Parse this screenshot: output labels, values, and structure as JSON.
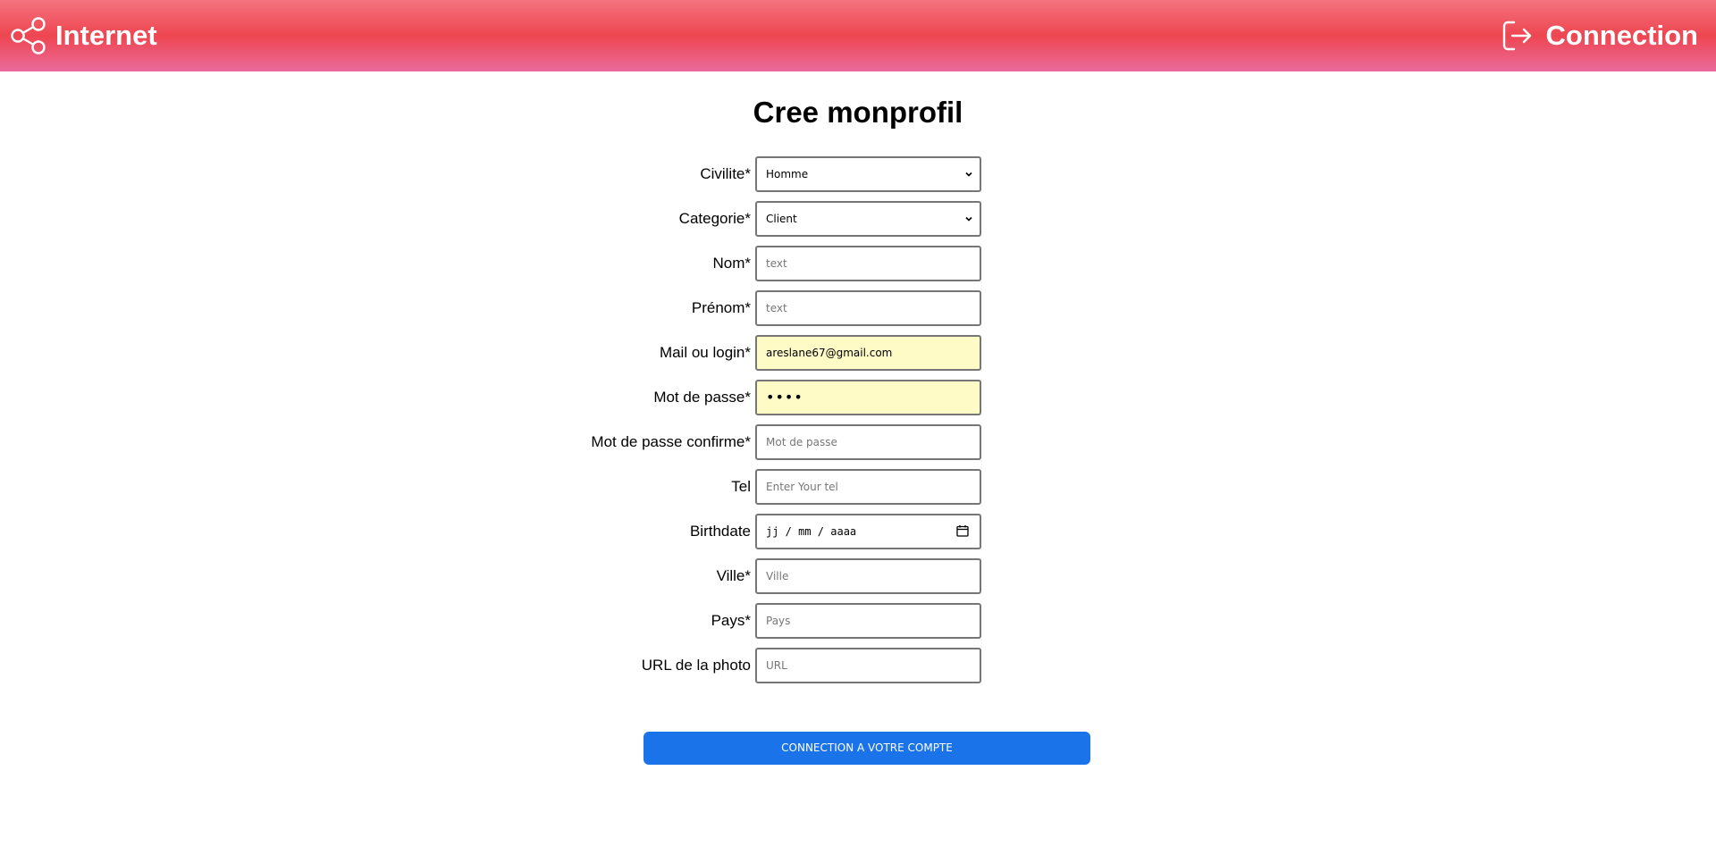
{
  "header": {
    "brand_label": "Internet",
    "connection_label": "Connection",
    "brand_icon": "share-icon",
    "connection_icon": "logout-icon"
  },
  "page": {
    "title": "Cree monprofil"
  },
  "form": {
    "civilite": {
      "label": "Civilite*",
      "value": "Homme"
    },
    "categorie": {
      "label": "Categorie*",
      "value": "Client"
    },
    "nom": {
      "label": "Nom*",
      "placeholder": "text"
    },
    "prenom": {
      "label": "Prénom*",
      "placeholder": "text"
    },
    "mail": {
      "label": "Mail ou login*",
      "value": "areslane67@gmail.com"
    },
    "password": {
      "label": "Mot de passe*",
      "value": "••••"
    },
    "password_confirm": {
      "label": "Mot de passe confirme*",
      "placeholder": "Mot de passe"
    },
    "tel": {
      "label": "Tel",
      "placeholder": "Enter Your tel"
    },
    "birthdate": {
      "label": "Birthdate",
      "value": "jj / mm / aaaa"
    },
    "ville": {
      "label": "Ville*",
      "placeholder": "Ville"
    },
    "pays": {
      "label": "Pays*",
      "placeholder": "Pays"
    },
    "photo_url": {
      "label": "URL de la photo",
      "placeholder": "URL"
    }
  },
  "actions": {
    "submit_label": "CONNECTION A VOTRE COMPTE"
  },
  "colors": {
    "header_gradient_top": "#f47380",
    "header_gradient_mid": "#ee4650",
    "header_gradient_bottom": "#ea6a9c",
    "submit_button": "#1a73e8",
    "autofill_background": "#fefbc6"
  }
}
